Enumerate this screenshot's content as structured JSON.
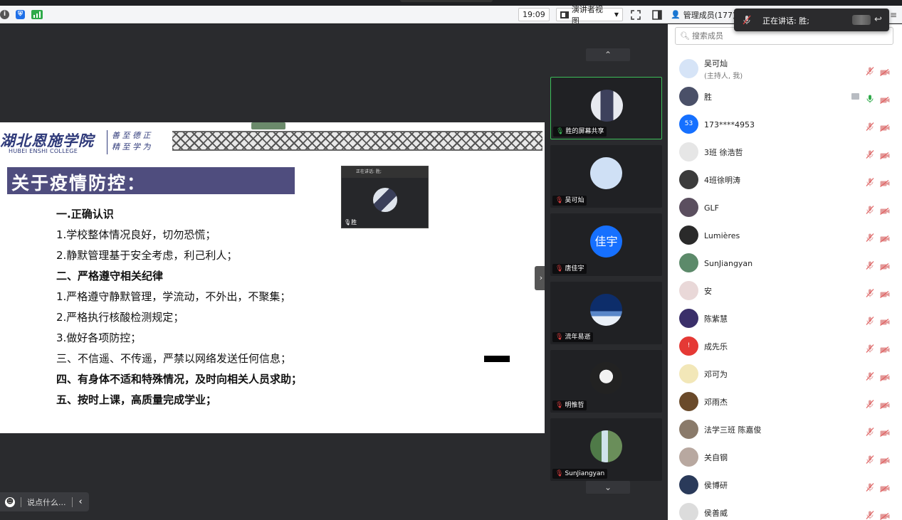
{
  "topbar": {
    "time": "19:09",
    "presenter_view_label": "演讲者视图",
    "manage_members_label": "管理成员(177)"
  },
  "toast": {
    "text": "正在讲话: 胜;"
  },
  "slide": {
    "college_cn": "湖北恩施学院",
    "college_en": "HUBEI ENSHI COLLEGE",
    "motto_line1": "善 至 德 正",
    "motto_line2": "精 至 学 为",
    "title": "关于疫情防控：",
    "lines": [
      {
        "text": "一.正确认识",
        "bold": true
      },
      {
        "text": "1.学校整体情况良好，切勿恐慌；",
        "bold": false
      },
      {
        "text": "2.静默管理基于安全考虑，利己利人；",
        "bold": false
      },
      {
        "text": "二、严格遵守相关纪律",
        "bold": true
      },
      {
        "text": "1.严格遵守静默管理，学流动，不外出，不聚集；",
        "bold": false
      },
      {
        "text": "2.严格执行核酸检测规定；",
        "bold": false
      },
      {
        "text": "3.做好各项防控；",
        "bold": false
      },
      {
        "text": "三、不信遥、不传遥，严禁以网络发送任何信息；",
        "bold": false
      },
      {
        "text": "四、有身体不适和特殊情况，及时向相关人员求助；",
        "bold": true
      },
      {
        "text": "五、按时上课，高质量完成学业；",
        "bold": true
      }
    ]
  },
  "mini_window": {
    "top_text": "正在讲话: 胜;",
    "name": "胜"
  },
  "chat": {
    "placeholder": "说点什么..."
  },
  "video_tiles": [
    {
      "name": "胜的屏幕共享",
      "active": true,
      "avatar": "photo-figure",
      "color": "#5a5f7a"
    },
    {
      "name": "吴可灿",
      "active": false,
      "avatar": "light-blue",
      "color": "#cfe0f5"
    },
    {
      "name": "唐佳宇",
      "active": false,
      "avatar": "text",
      "text": "佳宇",
      "color": "#1670ff"
    },
    {
      "name": "流年易逝",
      "active": false,
      "avatar": "sky",
      "color": "#2a5ea8"
    },
    {
      "name": "明惟哲",
      "active": false,
      "avatar": "anime",
      "color": "#c9c9c9"
    },
    {
      "name": "SunJiangyan",
      "active": false,
      "avatar": "waterfall",
      "color": "#5c8a6a"
    }
  ],
  "panel": {
    "search_placeholder": "搜索成员",
    "members": [
      {
        "name": "吴可灿",
        "sub": "(主持人, 我)",
        "color": "#d6e4f7",
        "mic": "muted",
        "cam": "off"
      },
      {
        "name": "胜",
        "sub": "",
        "color": "#4a5068",
        "mic": "active",
        "cam": "off",
        "screen": true
      },
      {
        "name": "173****4953",
        "sub": "",
        "color": "#1670ff",
        "text": "53",
        "mic": "muted",
        "cam": "off"
      },
      {
        "name": "3班 徐浩哲",
        "sub": "",
        "color": "#e6e6e6",
        "mic": "muted",
        "cam": "off"
      },
      {
        "name": "4班徐明涛",
        "sub": "",
        "color": "#3b3b3b",
        "mic": "muted",
        "cam": "off"
      },
      {
        "name": "GLF",
        "sub": "",
        "color": "#5b4f5f",
        "mic": "muted",
        "cam": "off"
      },
      {
        "name": "Lumières",
        "sub": "",
        "color": "#2a2a2a",
        "mic": "muted",
        "cam": "off"
      },
      {
        "name": "SunJiangyan",
        "sub": "",
        "color": "#5c8a6a",
        "mic": "muted",
        "cam": "off"
      },
      {
        "name": "安",
        "sub": "",
        "color": "#e9d8d8",
        "mic": "muted",
        "cam": "off"
      },
      {
        "name": "陈紫慧",
        "sub": "",
        "color": "#3a2f6a",
        "mic": "muted",
        "cam": "off"
      },
      {
        "name": "成先乐",
        "sub": "",
        "color": "#e53935",
        "text": "!",
        "mic": "muted",
        "cam": "off"
      },
      {
        "name": "邓可为",
        "sub": "",
        "color": "#f2e7b8",
        "mic": "muted",
        "cam": "off"
      },
      {
        "name": "邓雨杰",
        "sub": "",
        "color": "#6a4a2a",
        "mic": "muted",
        "cam": "off"
      },
      {
        "name": "法学三班 陈嘉俊",
        "sub": "",
        "color": "#8a7a6a",
        "mic": "muted",
        "cam": "off"
      },
      {
        "name": "关自钢",
        "sub": "",
        "color": "#b8a8a0",
        "mic": "muted",
        "cam": "off"
      },
      {
        "name": "侯博研",
        "sub": "",
        "color": "#2a3a5a",
        "mic": "muted",
        "cam": "off"
      },
      {
        "name": "侯善威",
        "sub": "",
        "color": "#dcdcdc",
        "mic": "muted",
        "cam": "off"
      }
    ]
  }
}
